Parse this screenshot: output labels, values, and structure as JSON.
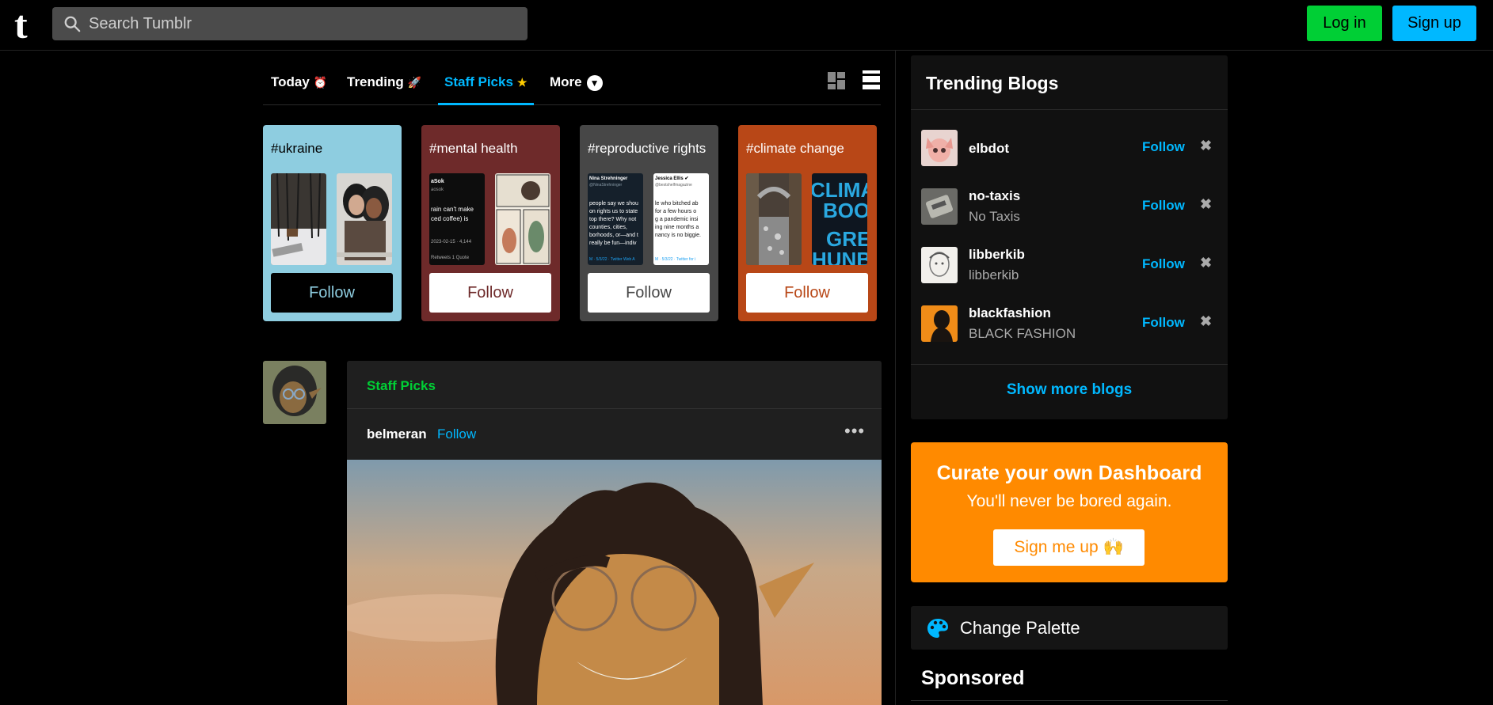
{
  "header": {
    "logo": "t",
    "search_placeholder": "Search Tumblr",
    "login_label": "Log in",
    "signup_label": "Sign up"
  },
  "tabs": {
    "today": "Today",
    "today_emoji": "⏰",
    "trending": "Trending",
    "trending_emoji": "🚀",
    "staff_picks": "Staff Picks",
    "staff_picks_emoji": "★",
    "more": "More",
    "active": "Staff Picks"
  },
  "tag_cards": [
    {
      "tag": "#ukraine",
      "follow": "Follow",
      "bg": "#8ecde0",
      "btn_bg": "#000000",
      "btn_fg": "#8ecde0",
      "text": "#000000"
    },
    {
      "tag": "#mental health",
      "follow": "Follow",
      "bg": "#6e2a2a",
      "btn_bg": "#ffffff",
      "btn_fg": "#6e2a2a",
      "text": "#ffffff"
    },
    {
      "tag": "#reproductive rights",
      "follow": "Follow",
      "bg": "#474747",
      "btn_bg": "#ffffff",
      "btn_fg": "#474747",
      "text": "#ffffff"
    },
    {
      "tag": "#climate change",
      "follow": "Follow",
      "bg": "#b84717",
      "btn_bg": "#ffffff",
      "btn_fg": "#b84717",
      "text": "#ffffff"
    }
  ],
  "post": {
    "source": "Staff Picks",
    "author": "belmeran",
    "follow": "Follow",
    "menu": "•••"
  },
  "trending_blogs": {
    "title": "Trending Blogs",
    "items": [
      {
        "name": "elbdot",
        "subtitle": "",
        "follow": "Follow",
        "dismiss": "✖"
      },
      {
        "name": "no-taxis",
        "subtitle": "No Taxis",
        "follow": "Follow",
        "dismiss": "✖"
      },
      {
        "name": "libberkib",
        "subtitle": "libberkib",
        "follow": "Follow",
        "dismiss": "✖"
      },
      {
        "name": "blackfashion",
        "subtitle": "BLACK FASHION",
        "follow": "Follow",
        "dismiss": "✖"
      }
    ],
    "show_more": "Show more blogs"
  },
  "curate": {
    "title": "Curate your own Dashboard",
    "subtitle": "You'll never be bored again.",
    "button": "Sign me up 🙌"
  },
  "palette": {
    "label": "Change Palette",
    "icon": "palette-icon"
  },
  "sponsored": {
    "label": "Sponsored"
  },
  "colors": {
    "accent_blue": "#00b8ff",
    "accent_green": "#00cf35",
    "accent_orange": "#ff8a00",
    "background": "#000000"
  }
}
